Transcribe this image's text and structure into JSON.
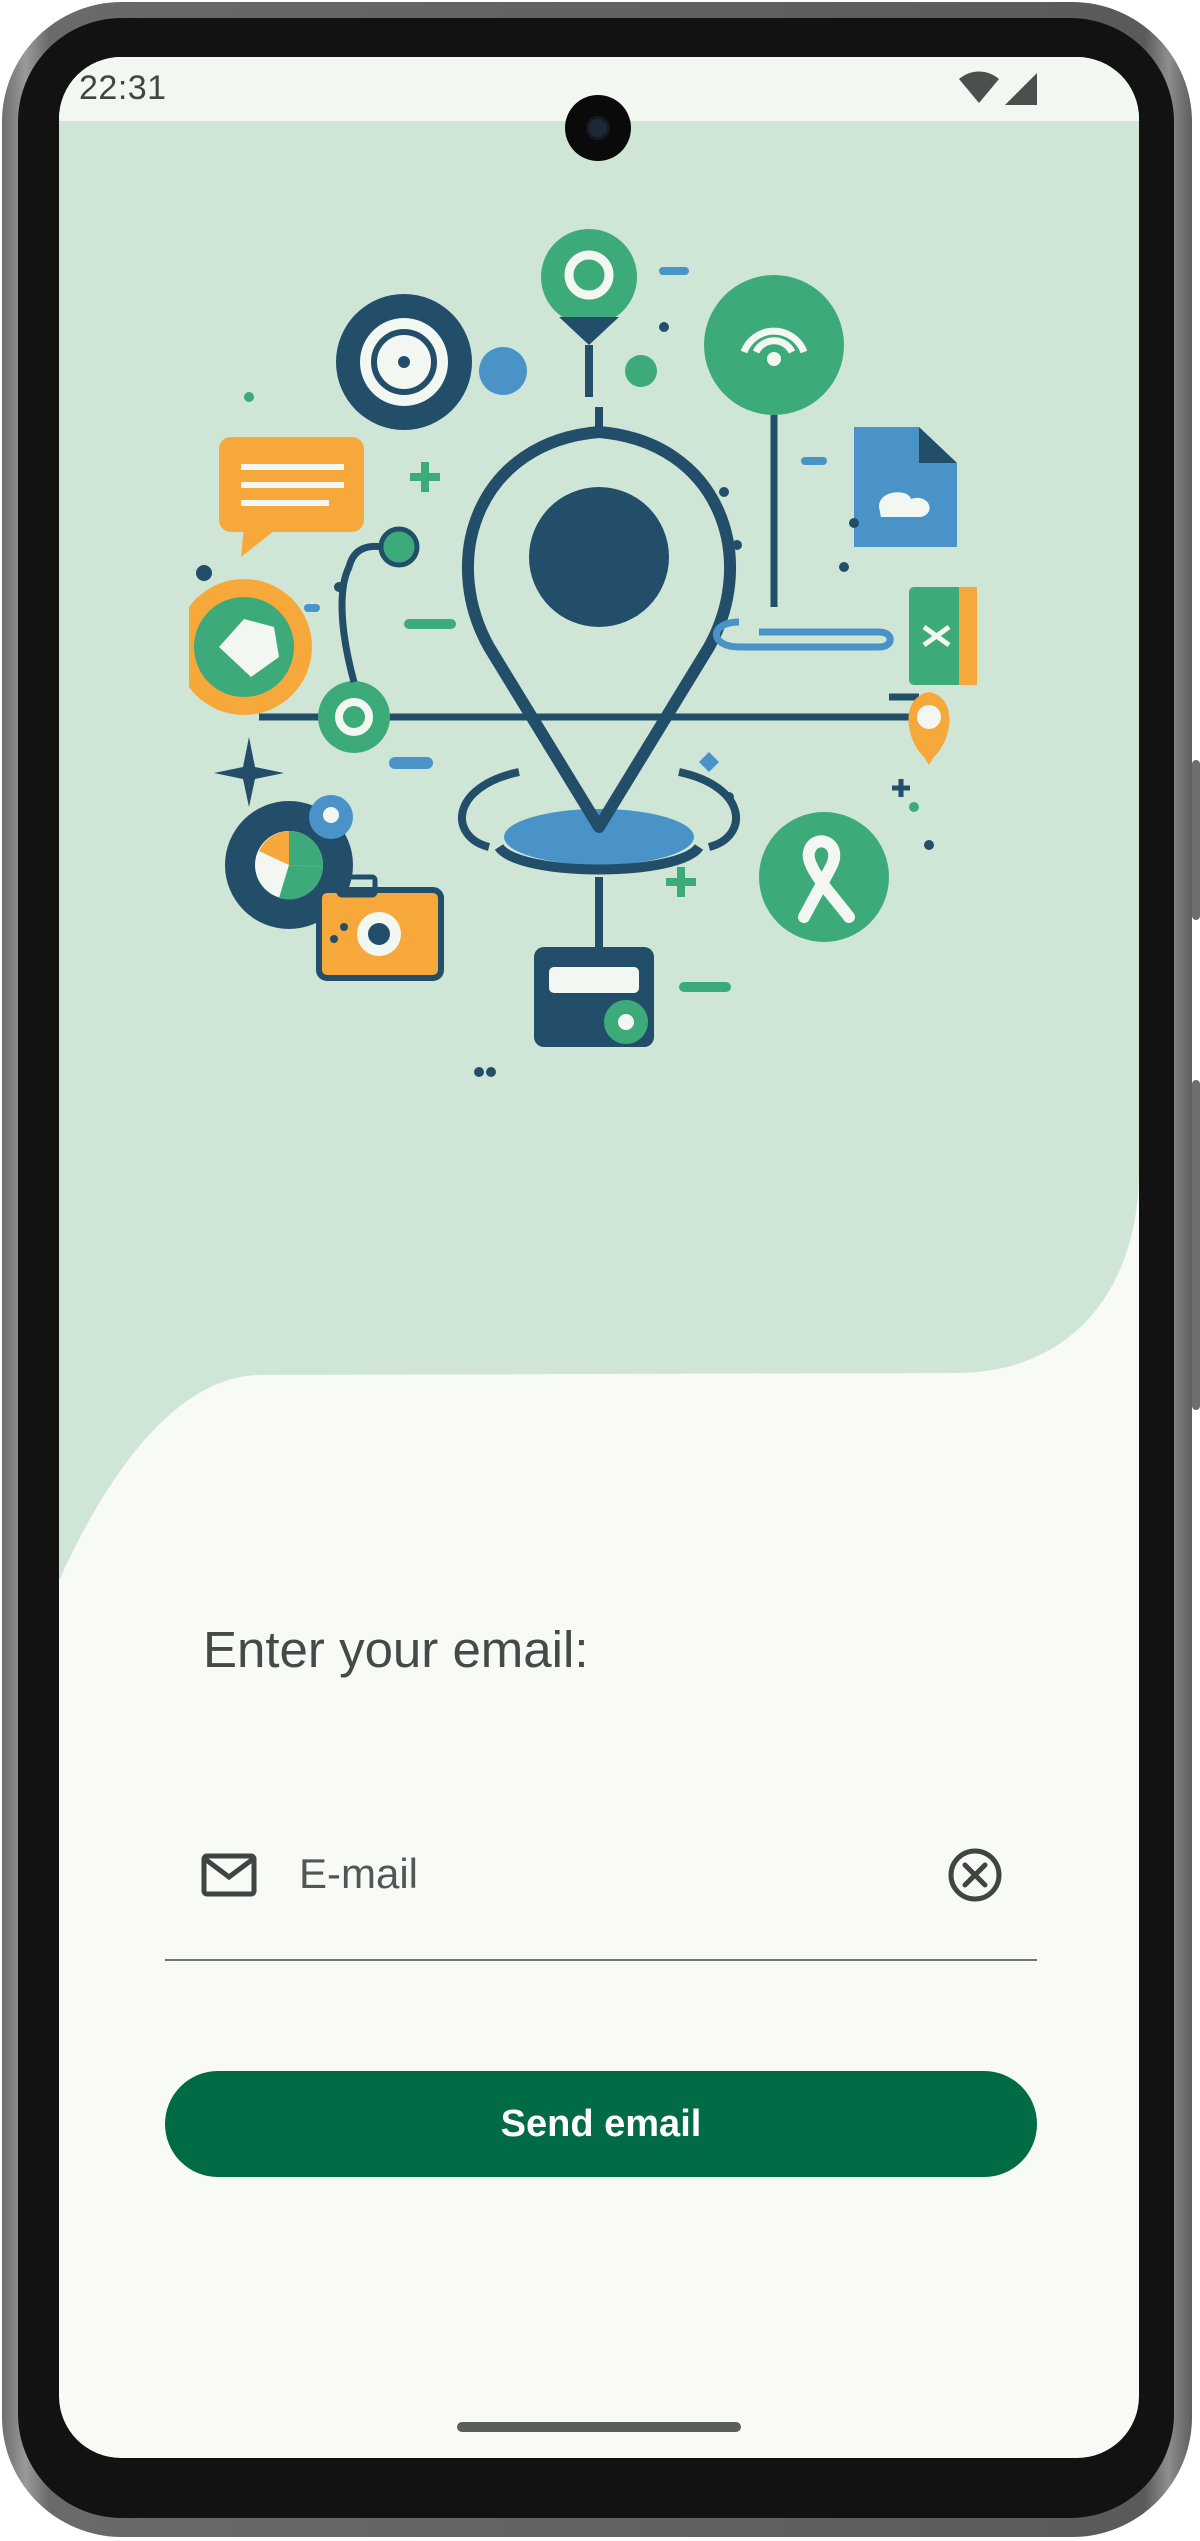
{
  "status_bar": {
    "time": "22:31",
    "icons": [
      "wifi-icon",
      "signal-icon"
    ]
  },
  "hero": {
    "illustration": "location-pin-services-illustration"
  },
  "form": {
    "prompt_label": "Enter your email:",
    "email_placeholder": "E-mail",
    "email_value": "",
    "leading_icon": "mail-icon",
    "trailing_icon": "clear-icon"
  },
  "actions": {
    "send_label": "Send email"
  },
  "colors": {
    "hero_background": "#cfe6d7",
    "screen_background": "#f7faf5",
    "primary_button": "#006b45",
    "dark_navy": "#234e69",
    "accent_green": "#3daa7a",
    "accent_orange": "#f7a83b",
    "accent_blue": "#4a93c8"
  }
}
